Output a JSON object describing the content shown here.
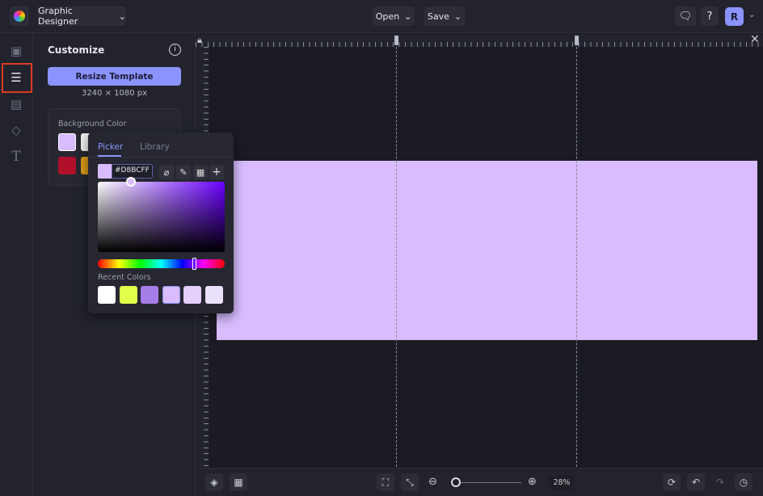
{
  "header": {
    "workspace": "Graphic Designer",
    "open": "Open",
    "save": "Save",
    "avatar_initial": "R"
  },
  "panel": {
    "title": "Customize",
    "resize_button": "Resize Template",
    "dimensions": "3240 × 1080 px",
    "background_label": "Background Color"
  },
  "picker": {
    "tabs": [
      "Picker",
      "Library"
    ],
    "active_tab": "Picker",
    "hex_value": "#D8BCFF",
    "recent_label": "Recent Colors",
    "recent_colors": [
      "#ffffff",
      "#e2ff4a",
      "#a67ee8",
      "#d8bcff",
      "#e3d0fb",
      "#ebe0fb"
    ],
    "hue_position": 0.76
  },
  "canvas": {
    "background": "#d8bcff"
  },
  "bottom": {
    "zoom": "28%",
    "zoom_slider": 0.05
  },
  "colors": {
    "accent": "#8a93ff",
    "highlight": "#e03a22"
  }
}
